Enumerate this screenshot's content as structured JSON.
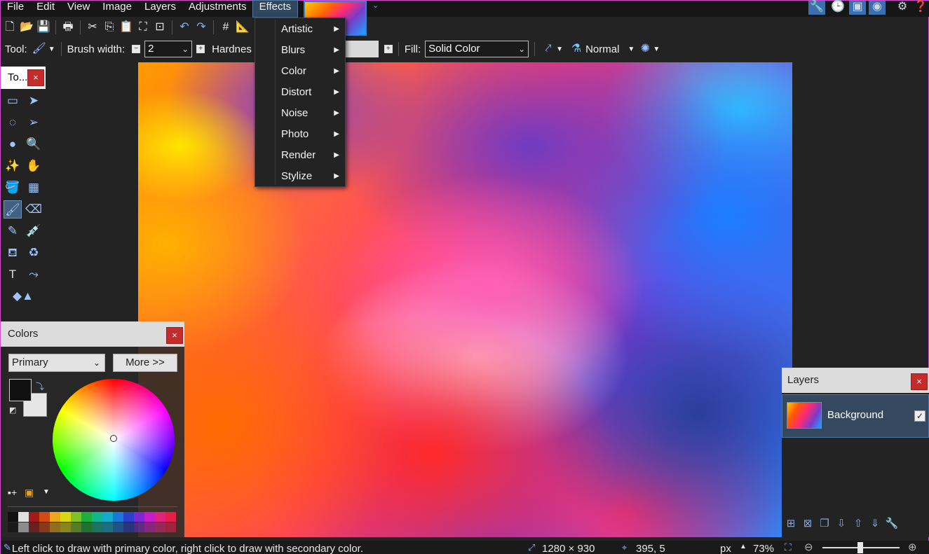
{
  "menubar": {
    "items": [
      "File",
      "Edit",
      "View",
      "Image",
      "Layers",
      "Adjustments",
      "Effects"
    ]
  },
  "effects_menu": {
    "items": [
      "Artistic",
      "Blurs",
      "Color",
      "Distort",
      "Noise",
      "Photo",
      "Render",
      "Stylize"
    ]
  },
  "optbar": {
    "tool_label": "Tool:",
    "brush_width_label": "Brush width:",
    "brush_width_value": "2",
    "hardness_label": "Hardnes",
    "fill_label": "Fill:",
    "fill_value": "Solid Color",
    "blend_mode": "Normal"
  },
  "tools_panel": {
    "title": "To...",
    "close": "×"
  },
  "colors_panel": {
    "title": "Colors",
    "close": "×",
    "mode_value": "Primary",
    "more_label": "More >>",
    "palette": [
      "#111111",
      "#e0e0e0",
      "#a11b1b",
      "#d44a14",
      "#e8a81a",
      "#d9d614",
      "#7ec224",
      "#1fae3c",
      "#12b58c",
      "#14aacb",
      "#1a78d6",
      "#2b3fc8",
      "#7a2ad0",
      "#c21fc6",
      "#e0247c",
      "#e61f4a"
    ]
  },
  "layers_panel": {
    "title": "Layers",
    "close": "×",
    "layer_name": "Background",
    "check": "✓"
  },
  "statusbar": {
    "hint": "Left click to draw with primary color, right click to draw with secondary color.",
    "image_size": "1280 × 930",
    "cursor_pos": "395, 5",
    "unit": "px",
    "zoom": "73%"
  },
  "icons": {
    "new": "new-file-icon",
    "open": "open-folder-icon",
    "save": "save-icon",
    "print": "print-icon",
    "cut": "cut-icon",
    "copy": "copy-icon",
    "paste": "paste-icon",
    "crop": "crop-icon",
    "undo": "undo-icon",
    "redo": "redo-icon",
    "grid": "grid-icon",
    "ruler": "ruler-icon"
  }
}
